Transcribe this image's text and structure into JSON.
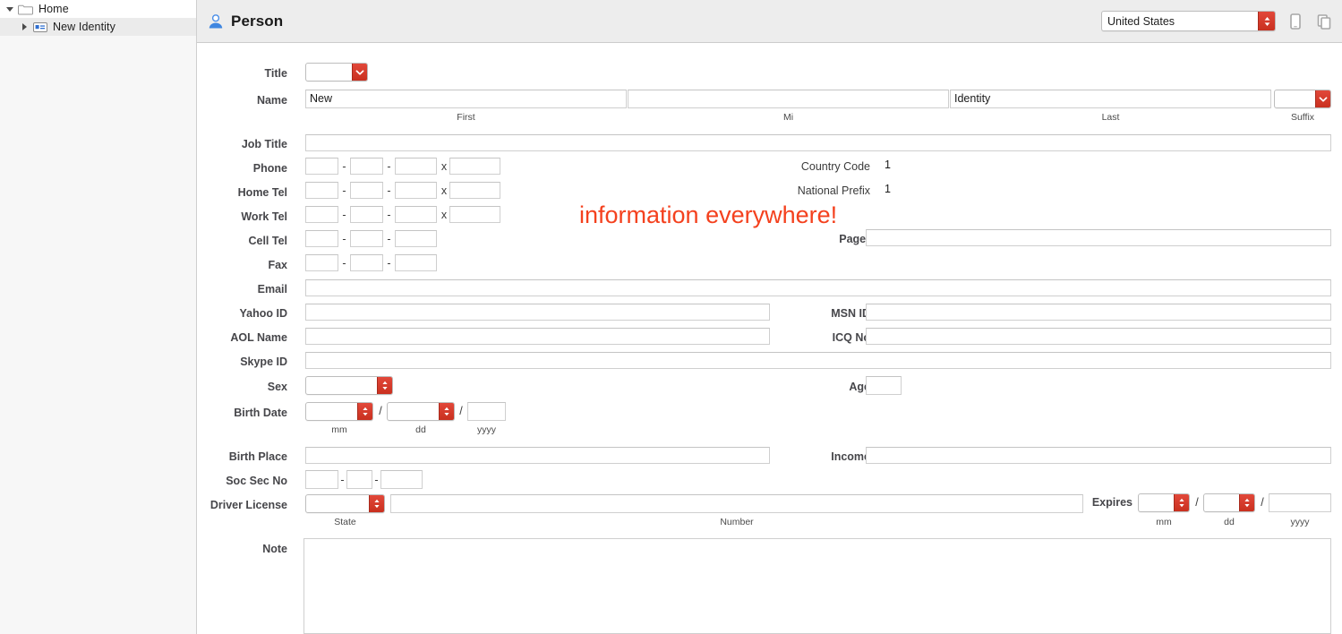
{
  "sidebar": {
    "items": [
      {
        "label": "Home",
        "icon": "folder-icon",
        "twisty": "open",
        "level": 0
      },
      {
        "label": "New Identity",
        "icon": "id-card-icon",
        "twisty": "closed",
        "level": 1
      }
    ]
  },
  "header": {
    "title": "Person",
    "icon": "person-icon",
    "country": {
      "value": "United States",
      "stepper": "up-down-stepper"
    },
    "icons": [
      {
        "name": "mobile-device-icon"
      },
      {
        "name": "duplicate-icon"
      }
    ]
  },
  "watermark": {
    "text": "information everywhere!",
    "color": "#f4411e"
  },
  "form": {
    "title": {
      "label": "Title",
      "value": ""
    },
    "name": {
      "label": "Name",
      "first": {
        "value": "New",
        "sub": "First"
      },
      "mi": {
        "value": "",
        "sub": "Mi"
      },
      "last": {
        "value": "Identity",
        "sub": "Last"
      },
      "suffix": {
        "value": "",
        "sub": "Suffix"
      }
    },
    "job_title": {
      "label": "Job Title",
      "value": ""
    },
    "phone": {
      "label": "Phone",
      "p1": "",
      "p2": "",
      "p3": "",
      "ext": "",
      "ext_label": "x"
    },
    "home_tel": {
      "label": "Home Tel",
      "p1": "",
      "p2": "",
      "p3": "",
      "ext": "",
      "ext_label": "x"
    },
    "work_tel": {
      "label": "Work Tel",
      "p1": "",
      "p2": "",
      "p3": "",
      "ext": "",
      "ext_label": "x"
    },
    "cell_tel": {
      "label": "Cell Tel",
      "p1": "",
      "p2": "",
      "p3": ""
    },
    "fax": {
      "label": "Fax",
      "p1": "",
      "p2": "",
      "p3": ""
    },
    "country_code": {
      "label": "Country Code",
      "value": "1"
    },
    "national_prefix": {
      "label": "National Prefix",
      "value": "1"
    },
    "pager": {
      "label": "Pager",
      "value": ""
    },
    "email": {
      "label": "Email",
      "value": ""
    },
    "yahoo_id": {
      "label": "Yahoo ID",
      "value": ""
    },
    "msn_id": {
      "label": "MSN ID",
      "value": ""
    },
    "aol_name": {
      "label": "AOL Name",
      "value": ""
    },
    "icq_no": {
      "label": "ICQ No",
      "value": ""
    },
    "skype_id": {
      "label": "Skype ID",
      "value": ""
    },
    "sex": {
      "label": "Sex",
      "value": ""
    },
    "age": {
      "label": "Age",
      "value": ""
    },
    "birth_date": {
      "label": "Birth Date",
      "mm": {
        "value": "",
        "sub": "mm"
      },
      "dd": {
        "value": "",
        "sub": "dd"
      },
      "yyyy": {
        "value": "",
        "sub": "yyyy"
      },
      "slash": "/"
    },
    "birth_place": {
      "label": "Birth Place",
      "value": ""
    },
    "income": {
      "label": "Income",
      "value": ""
    },
    "soc_sec_no": {
      "label": "Soc Sec No",
      "p1": "",
      "p2": "",
      "p3": "",
      "dash": "-"
    },
    "driver_license": {
      "label": "Driver License",
      "state": {
        "value": "",
        "sub": "State"
      },
      "number": {
        "value": "",
        "sub": "Number"
      }
    },
    "expires": {
      "label": "Expires",
      "mm": {
        "value": "",
        "sub": "mm"
      },
      "dd": {
        "value": "",
        "sub": "dd"
      },
      "yyyy": {
        "value": "",
        "sub": "yyyy"
      },
      "slash": "/"
    },
    "note": {
      "label": "Note",
      "value": ""
    }
  }
}
